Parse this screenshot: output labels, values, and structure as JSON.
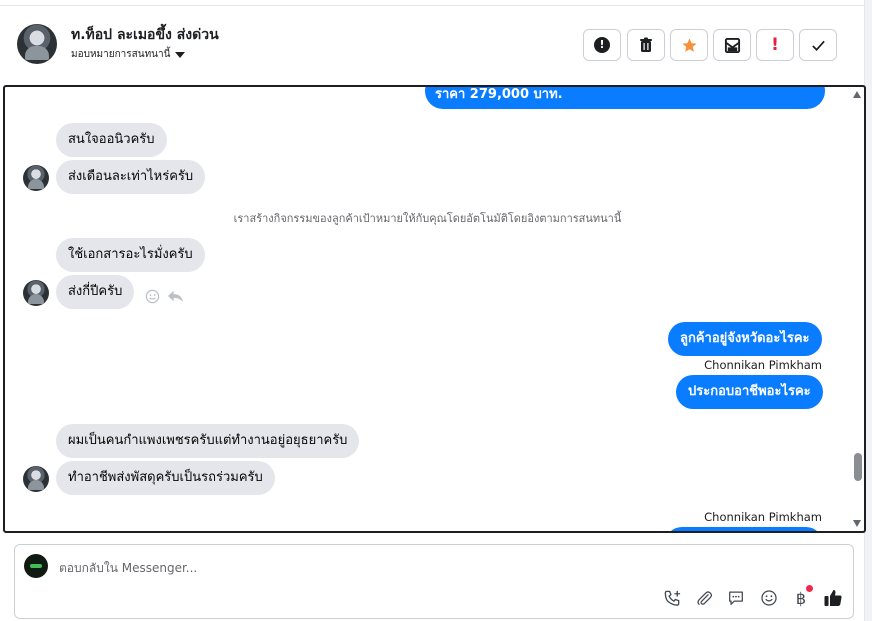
{
  "header": {
    "contact_name": "ท.ท็อป ละเมอขึ้ง ส่งด่วน",
    "assign_label": "มอบหมายการสนทนานี้"
  },
  "toolbar": {
    "buttons": [
      {
        "name": "mark-spam",
        "icon": "exclamation-circle-icon"
      },
      {
        "name": "delete",
        "icon": "trash-icon"
      },
      {
        "name": "star",
        "icon": "star-icon",
        "color": "#f7923b"
      },
      {
        "name": "mark-unread",
        "icon": "envelope-icon"
      },
      {
        "name": "follow-up",
        "icon": "red-exclamation-icon",
        "color": "#e41e3f"
      },
      {
        "name": "mark-done",
        "icon": "checkmark-icon"
      }
    ],
    "follow_up_glyph": "!"
  },
  "conversation": {
    "top_partial_outgoing": "ราคา 279,000 บาท.",
    "incoming_1": "สนใจออนิวครับ",
    "incoming_2": "ส่งเดือนละเท่าไหร่ครับ",
    "system_note": "เราสร้างกิจกรรมของลูกค้าเป้าหมายให้กับคุณโดยอัตโนมัติโดยอิงตามการสนทนานี้",
    "incoming_3": "ใช้เอกสารอะไรมั่งครับ",
    "incoming_4": "ส่งกี่ปีครับ",
    "outgoing_1": "ลูกค้าอยู่จังหวัดอะไรคะ",
    "sender_1": "Chonnikan Pimkham",
    "outgoing_2": "ประกอบอาชีพอะไรคะ",
    "incoming_5": "ผมเป็นคนกำแพงเพชรครับแต่ทำงานอยู่อยุธยาครับ",
    "incoming_6": "ทำอาชีพส่งพัสดุครับเป็นรถร่วมครับ",
    "sender_2": "Chonnikan Pimkham"
  },
  "composer": {
    "placeholder": "ตอบกลับใน Messenger...",
    "currency_glyph": "฿",
    "tools": [
      "call-add-icon",
      "paperclip-icon",
      "saved-reply-icon",
      "emoji-icon",
      "baht-icon",
      "thumbs-up-icon"
    ],
    "accent": "#0a7cff"
  }
}
